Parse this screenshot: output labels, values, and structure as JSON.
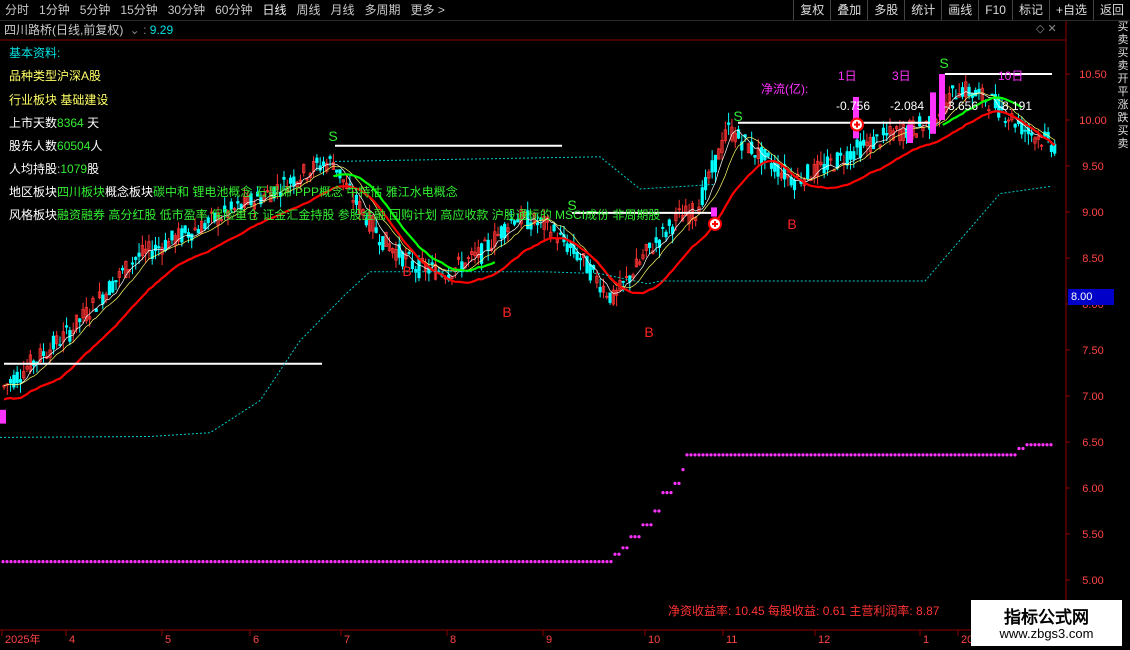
{
  "toolbar": {
    "tabs": [
      "分时",
      "1分钟",
      "5分钟",
      "15分钟",
      "30分钟",
      "60分钟",
      "日线",
      "周线",
      "月线",
      "多周期",
      "更多 >"
    ],
    "active": "日线",
    "right_buttons": [
      "复权",
      "叠加",
      "多股",
      "统计",
      "画线",
      "F10",
      "标记",
      "+自选",
      "返回"
    ]
  },
  "info": {
    "title": "四川路桥(日线,前复权)",
    "value": "9.29"
  },
  "fundamentals": {
    "header": "基本资料:",
    "type_label": "品种类型",
    "type_value": "沪深A股",
    "industry_label": "行业板块",
    "industry_value": "基础建设",
    "days_label": "上市天数",
    "days_value": "8364",
    "days_unit": "天",
    "holders_label": "股东人数",
    "holders_value": "60504",
    "holders_unit": "人",
    "avg_label": "人均持股",
    "avg_value": "1079",
    "avg_unit": "股",
    "region_label": "地区板块",
    "region_value": "四川板块",
    "concept_label": "概念板块",
    "concept_value": "碳中和 锂电池概念 石墨烯 PPP概念 中特估 雅江水电概念",
    "style_label": "风格板块",
    "style_value": "融资融券 高分红股 低市盈率 保险重仓 证金汇金持股 参股金融 回购计划 高应收款 沪股通标的 MSCI成份 非周期股"
  },
  "flow": {
    "label": "净流(亿):",
    "periods": [
      "1日",
      "3日",
      "10日"
    ],
    "values": [
      "-0.756",
      "-2.084",
      "-3.656",
      "-8.191"
    ]
  },
  "signals": {
    "buy": "B",
    "sell": "S"
  },
  "footer_stats": {
    "text": "净资收益率: 10.45  每股收益: 0.61  主营利润率: 8.87"
  },
  "price_axis": [
    "10.50",
    "10.00",
    "9.50",
    "9.00",
    "8.50",
    "8.00",
    "7.50",
    "7.00",
    "6.50",
    "6.00",
    "5.50",
    "5.00"
  ],
  "current_price_tag": "8.00",
  "date_axis": [
    "2025年",
    "4",
    "5",
    "6",
    "7",
    "8",
    "9",
    "10",
    "11",
    "12",
    "1",
    "20"
  ],
  "watermark": {
    "line1": "指标公式网",
    "line2": "www.zbgs3.com"
  },
  "right_strip": [
    "买",
    "卖",
    "买",
    "卖",
    "开",
    "平",
    "涨",
    "跌",
    "买",
    "卖"
  ],
  "colors": {
    "up": "#ff3333",
    "down": "#00ffff",
    "ma": "#ff0000",
    "ma2": "#00ff00",
    "magenta": "#ff33ff",
    "label_green": "#33ee33",
    "label_yellow": "#ffff66"
  }
}
